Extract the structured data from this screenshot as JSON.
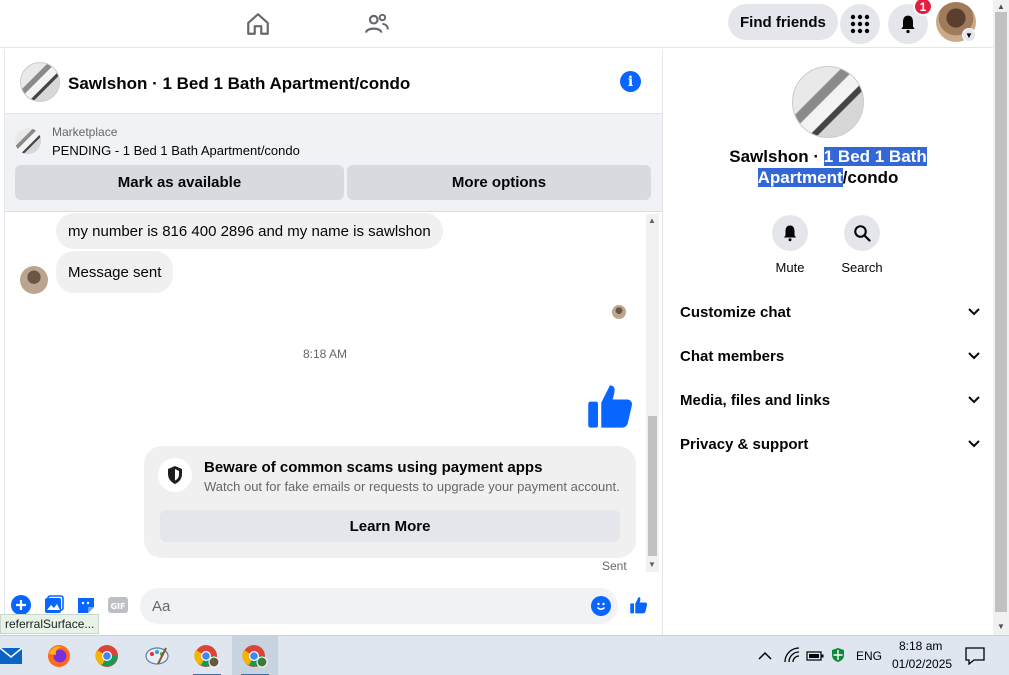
{
  "topbar": {
    "find_friends_label": "Find friends",
    "notification_count": "1"
  },
  "chat": {
    "title": "Sawlshon · 1 Bed 1 Bath Apartment/condo",
    "marketplace": {
      "label": "Marketplace",
      "status": "PENDING - 1 Bed 1 Bath Apartment/condo",
      "mark_available_label": "Mark as available",
      "more_options_label": "More options"
    },
    "messages": [
      {
        "text": "my number is 816 400 2896 and my name is sawlshon"
      },
      {
        "text": "Message sent"
      }
    ],
    "timestamp": "8:18 AM",
    "scam_card": {
      "title": "Beware of common scams using payment apps",
      "subtitle": "Watch out for fake emails or requests to upgrade your payment account.",
      "button_label": "Learn More"
    },
    "sent_label": "Sent",
    "composer": {
      "placeholder": "Aa",
      "gif_label": "GIF"
    },
    "status_tip": "referralSurface..."
  },
  "right_panel": {
    "name_prefix": "Sawlshon · ",
    "name_highlight": "1 Bed 1 Bath Apartment",
    "name_suffix": "/condo",
    "actions": [
      {
        "label": "Mute",
        "icon": "bell-icon"
      },
      {
        "label": "Search",
        "icon": "search-icon"
      }
    ],
    "sections": [
      {
        "label": "Customize chat"
      },
      {
        "label": "Chat members"
      },
      {
        "label": "Media, files and links"
      },
      {
        "label": "Privacy & support"
      }
    ]
  },
  "taskbar": {
    "language": "ENG",
    "time": "8:18 am",
    "date": "01/02/2025"
  },
  "colors": {
    "accent": "#0866ff",
    "badge": "#e41e3f",
    "selection": "#3367d6"
  }
}
